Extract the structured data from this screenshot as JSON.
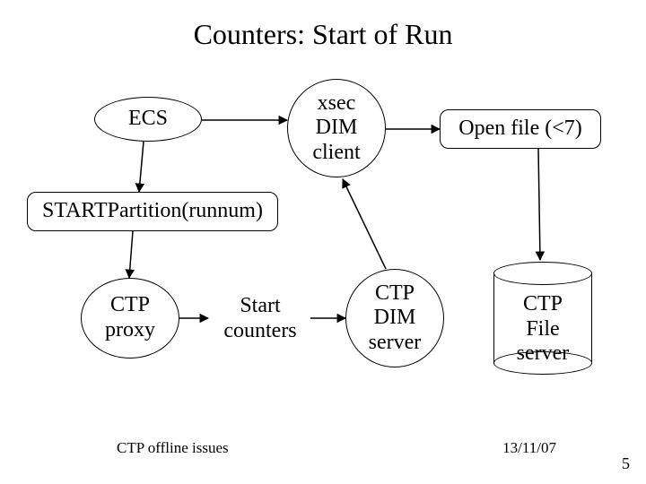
{
  "title": "Counters: Start of Run",
  "nodes": {
    "ecs": "ECS",
    "xsec": "xsec\nDIM\nclient",
    "openfile": "Open file (<7)",
    "startpart": "STARTPartition(runnum)",
    "ctpproxy": "CTP\nproxy",
    "startcounters": "Start\ncounters",
    "ctpdimserver": "CTP\nDIM\nserver",
    "ctpfileserver": "CTP\nFile\nserver"
  },
  "footer": {
    "left": "CTP offline issues",
    "right": "13/11/07",
    "page": "5"
  }
}
